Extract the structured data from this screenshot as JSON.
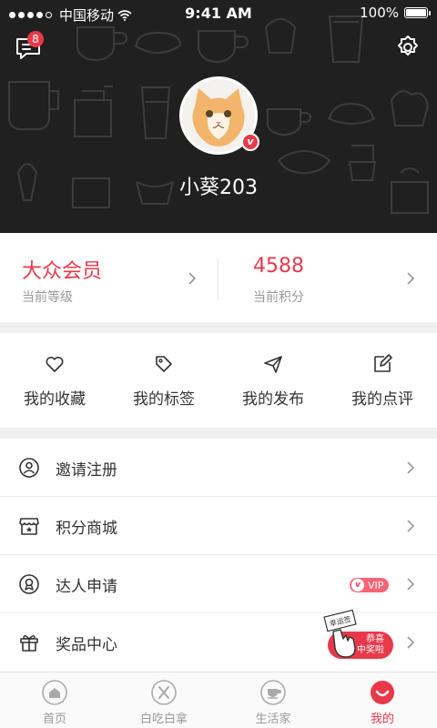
{
  "status_bar": {
    "carrier": "中国移动",
    "time": "9:41 AM",
    "battery": "100%",
    "battery_level": 1.0
  },
  "header": {
    "message_badge": "8",
    "message_icon": "message-icon",
    "settings_icon": "settings-gear-icon",
    "username": "小葵203",
    "avatar": "cat-avatar",
    "verified_badge": "v"
  },
  "stats": {
    "level": {
      "value": "大众会员",
      "label": "当前等级"
    },
    "points": {
      "value": "4588",
      "label": "当前积分"
    }
  },
  "actions": [
    {
      "label": "我的收藏",
      "icon": "heart-icon"
    },
    {
      "label": "我的标签",
      "icon": "tag-icon"
    },
    {
      "label": "我的发布",
      "icon": "send-icon"
    },
    {
      "label": "我的点评",
      "icon": "edit-icon"
    }
  ],
  "menu": [
    {
      "label": "邀请注册",
      "icon": "invite-icon"
    },
    {
      "label": "积分商城",
      "icon": "store-icon"
    },
    {
      "label": "达人申请",
      "icon": "badge-icon",
      "tag": "VIP",
      "tag_v": "v"
    },
    {
      "label": "奖品中心",
      "icon": "gift-icon"
    }
  ],
  "prize_float": {
    "sign": "幸运签",
    "line1": "恭喜",
    "line2": "中奖啦"
  },
  "tabbar": [
    {
      "label": "首页",
      "icon": "home-icon",
      "active": false
    },
    {
      "label": "白吃白拿",
      "icon": "cutlery-icon",
      "active": false
    },
    {
      "label": "生活家",
      "icon": "cup-icon",
      "active": false
    },
    {
      "label": "我的",
      "icon": "profile-icon",
      "active": true
    }
  ],
  "colors": {
    "accent": "#e8394a",
    "header_bg": "#202020",
    "muted_text": "#999999"
  }
}
